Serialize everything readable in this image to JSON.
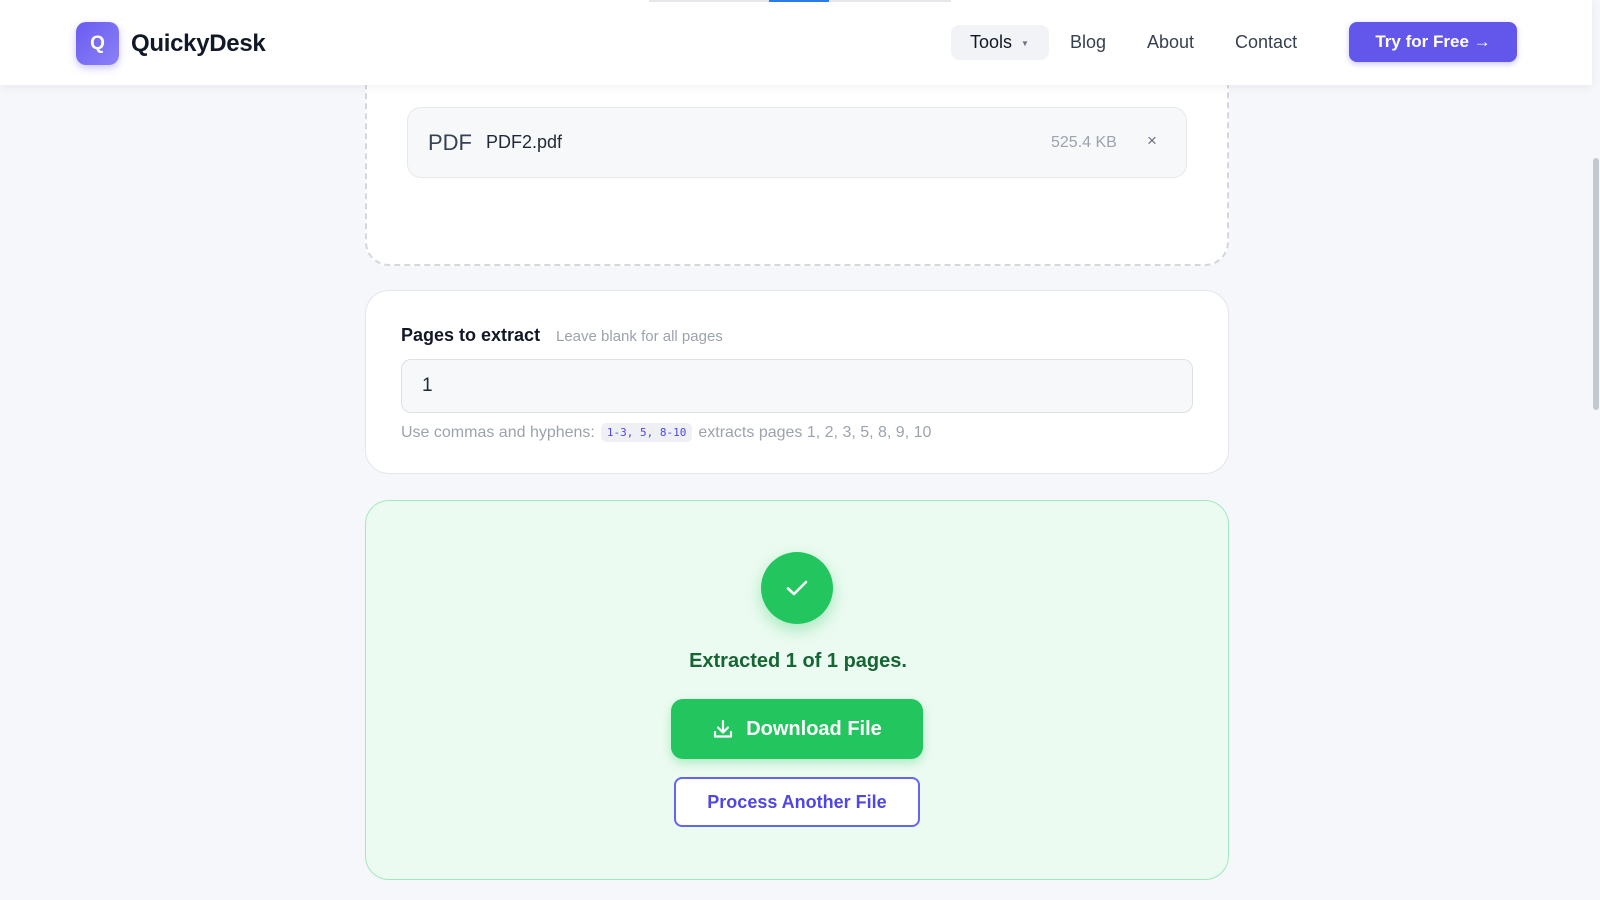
{
  "header": {
    "logo_letter": "Q",
    "brand": "QuickyDesk",
    "nav": {
      "tools": "Tools",
      "blog": "Blog",
      "about": "About",
      "contact": "Contact"
    },
    "cta": "Try for Free →"
  },
  "upload": {
    "file": {
      "type": "PDF",
      "name": "PDF2.pdf",
      "size": "525.4 KB",
      "remove": "×"
    }
  },
  "pages": {
    "label": "Pages to extract",
    "hint": "Leave blank for all pages",
    "value": "1",
    "help_prefix": "Use commas and hyphens:",
    "help_example": "1-3, 5, 8-10",
    "help_suffix": "extracts pages 1, 2, 3, 5, 8, 9, 10"
  },
  "result": {
    "message": "Extracted 1 of 1 pages.",
    "download_label": "Download File",
    "another_label": "Process Another File"
  },
  "colors": {
    "brand": "#6257ea",
    "success": "#22c55e",
    "success_bg": "#ecfbf1"
  }
}
